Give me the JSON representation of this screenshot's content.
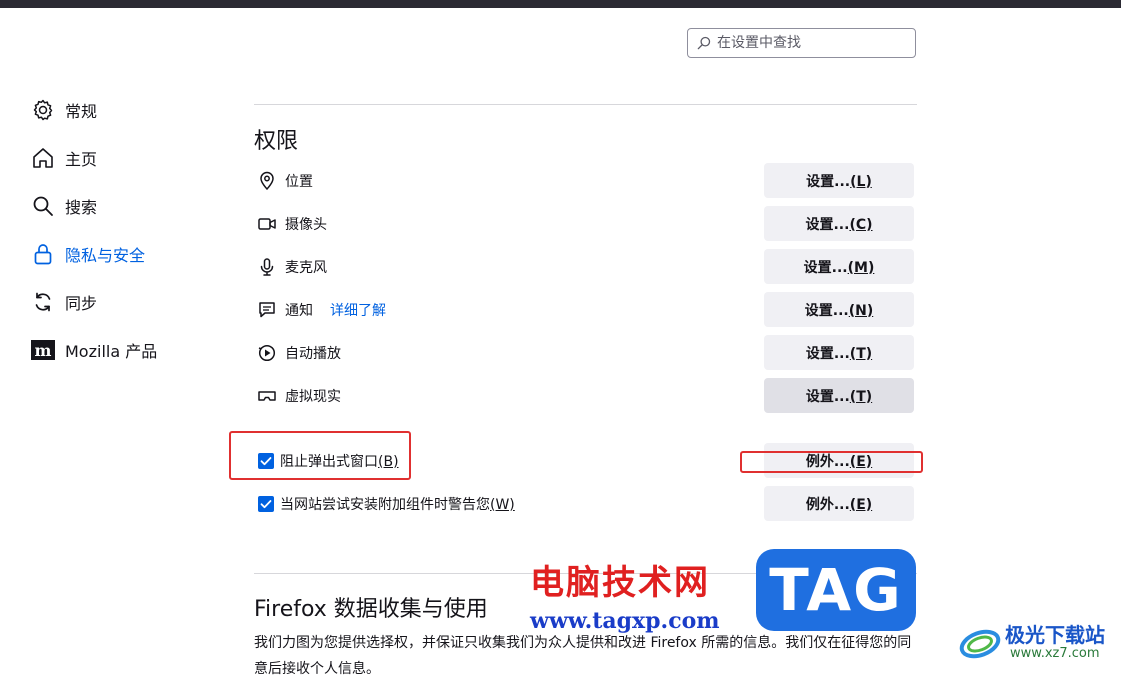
{
  "search": {
    "placeholder": "在设置中查找"
  },
  "sidebar": {
    "items": [
      {
        "label": "常规",
        "icon": "gear-icon"
      },
      {
        "label": "主页",
        "icon": "home-icon"
      },
      {
        "label": "搜索",
        "icon": "search-icon"
      },
      {
        "label": "隐私与安全",
        "icon": "lock-icon",
        "active": true
      },
      {
        "label": "同步",
        "icon": "sync-icon"
      },
      {
        "label": "Mozilla 产品",
        "icon": "mozilla-icon"
      }
    ],
    "active_color": "#0061e0"
  },
  "permissions": {
    "title": "权限",
    "rows": [
      {
        "label": "位置",
        "icon": "location-icon",
        "button": "设置...",
        "key": "(L)"
      },
      {
        "label": "摄像头",
        "icon": "camera-icon",
        "button": "设置...",
        "key": "(C)"
      },
      {
        "label": "麦克风",
        "icon": "microphone-icon",
        "button": "设置...",
        "key": "(M)"
      },
      {
        "label": "通知",
        "icon": "notification-icon",
        "link": "详细了解",
        "button": "设置...",
        "key": "(N)"
      },
      {
        "label": "自动播放",
        "icon": "autoplay-icon",
        "button": "设置...",
        "key": "(T)"
      },
      {
        "label": "虚拟现实",
        "icon": "vr-icon",
        "button": "设置...",
        "key": "(T)"
      }
    ],
    "checkboxes": [
      {
        "label": "阻止弹出式窗口",
        "key": "(B)",
        "checked": true,
        "button": "例外...",
        "button_key": "(E)"
      },
      {
        "label": "当网站尝试安装附加组件时警告您",
        "key": "(W)",
        "checked": true,
        "button": "例外...",
        "button_key": "(E)"
      }
    ]
  },
  "data_collection": {
    "title": "Firefox 数据收集与使用",
    "text": "我们力图为您提供选择权，并保证只收集我们为众人提供和改进 Firefox 所需的信息。我们仅在征得您的同意后接收个人信息。"
  },
  "watermarks": {
    "site_name": "电脑技术网",
    "site_url": "www.tagxp.com",
    "tag": "TAG",
    "brand": "极光下载站",
    "brand_url": "www.xz7.com"
  },
  "colors": {
    "accent": "#0061e0",
    "highlight_box": "#e03030"
  }
}
